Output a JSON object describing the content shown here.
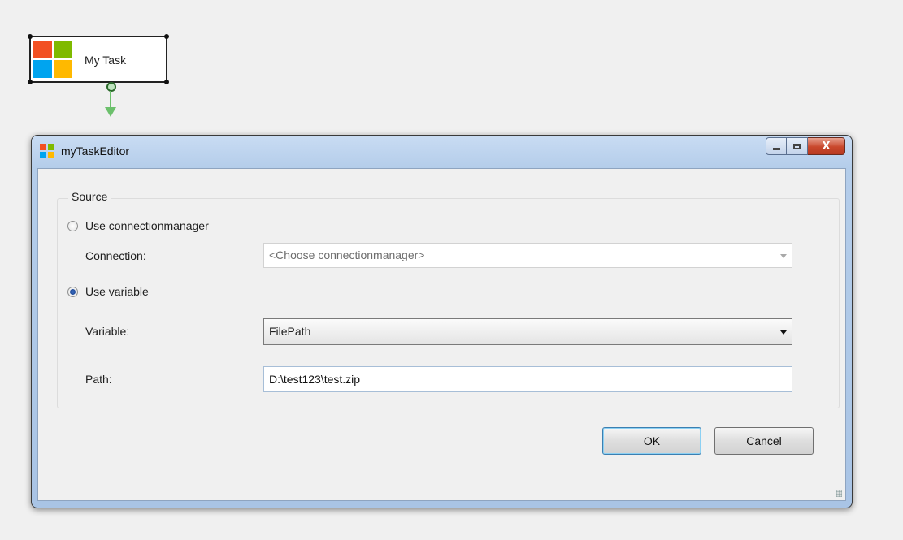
{
  "designer": {
    "task_label": "My Task"
  },
  "window": {
    "title": "myTaskEditor",
    "caption_buttons": {
      "minimize_icon": "minimize-icon",
      "maximize_icon": "maximize-icon",
      "close_glyph": "X"
    }
  },
  "source": {
    "legend": "Source",
    "use_connection_label": "Use connectionmanager",
    "connection_label": "Connection:",
    "connection_placeholder": "<Choose connectionmanager>",
    "use_variable_label": "Use variable",
    "variable_label": "Variable:",
    "variable_value": "FilePath",
    "path_label": "Path:",
    "path_value": "D:\\test123\\test.zip",
    "selected_option": "Use variable"
  },
  "buttons": {
    "ok": "OK",
    "cancel": "Cancel"
  },
  "colors": {
    "logo_red": "#f25022",
    "logo_green": "#7fba00",
    "logo_blue": "#00a4ef",
    "logo_yellow": "#ffb900",
    "connector_green": "#6cc06c",
    "close_button_red": "#c9472c"
  }
}
